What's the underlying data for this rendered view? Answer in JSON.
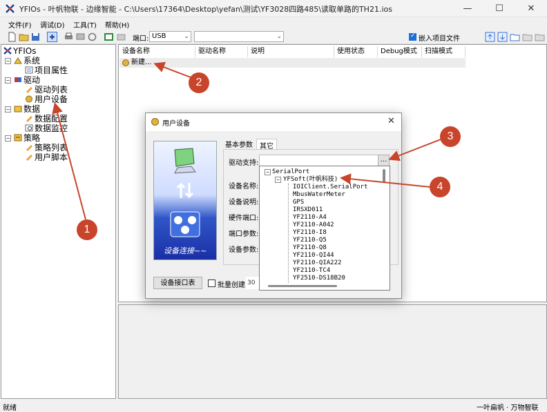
{
  "window": {
    "title": "YFIOs - 叶帆物联 - 边缘智能 - C:\\Users\\17364\\Desktop\\yefan\\测试\\YF3028四路485\\读取单路的TH21.ios",
    "minimize": "—",
    "maximize": "☐",
    "close": "✕"
  },
  "menu": [
    "文件(F)",
    "调试(D)",
    "工具(T)",
    "帮助(H)"
  ],
  "toolbar": {
    "port_label": "端口:",
    "port_value": "USB",
    "second_combo_value": "",
    "embed_label": "嵌入项目文件",
    "embed_checked": true
  },
  "tree": {
    "root": "YFIOs",
    "groups": [
      {
        "label": "系统",
        "items": [
          "项目属性"
        ]
      },
      {
        "label": "驱动",
        "items": [
          "驱动列表",
          "用户设备"
        ]
      },
      {
        "label": "数据",
        "items": [
          "数据配置",
          "数据监控"
        ]
      },
      {
        "label": "策略",
        "items": [
          "策略列表",
          "用户脚本"
        ]
      }
    ]
  },
  "grid": {
    "columns": [
      "设备名称",
      "驱动名称",
      "说明",
      "使用状态",
      "Debug模式",
      "扫描模式"
    ],
    "new_row": "新建..."
  },
  "dialog": {
    "title": "用户设备",
    "close": "✕",
    "tabs": [
      "基本参数",
      "其它"
    ],
    "driver_label": "驱动支持:",
    "browse_button": "...",
    "fields": [
      "设备名称:",
      "设备说明:",
      "硬件端口:",
      "端口参数:",
      "设备参数:"
    ],
    "image_caption": "设备连接~~",
    "device_port_button": "设备接口表",
    "batch_label": "批量创建",
    "batch_value": "30"
  },
  "driver_tree": {
    "root": "SerialPort",
    "vendor": "YFSoft(叶帆科技)",
    "items": [
      "IOIClient.SerialPort",
      "MbusWaterMeter",
      "GPS",
      "IRSXD011",
      "YF2110-A4",
      "YF2110-A042",
      "YF2110-I8",
      "YF2110-Q5",
      "YF2110-Q8",
      "YF2110-QI44",
      "YF2110-QIA222",
      "YF2110-TC4",
      "YF2510-DS18B20"
    ]
  },
  "status": {
    "left": "就绪",
    "right": "一叶扁帆 · 万物智联"
  },
  "annotations": [
    "1",
    "2",
    "3",
    "4"
  ],
  "colors": {
    "annotation": "#c8442a",
    "accent": "#1f6fd1",
    "dialog_banner_top": "#2f56c8",
    "dialog_banner_bottom": "#1b2fa5"
  }
}
